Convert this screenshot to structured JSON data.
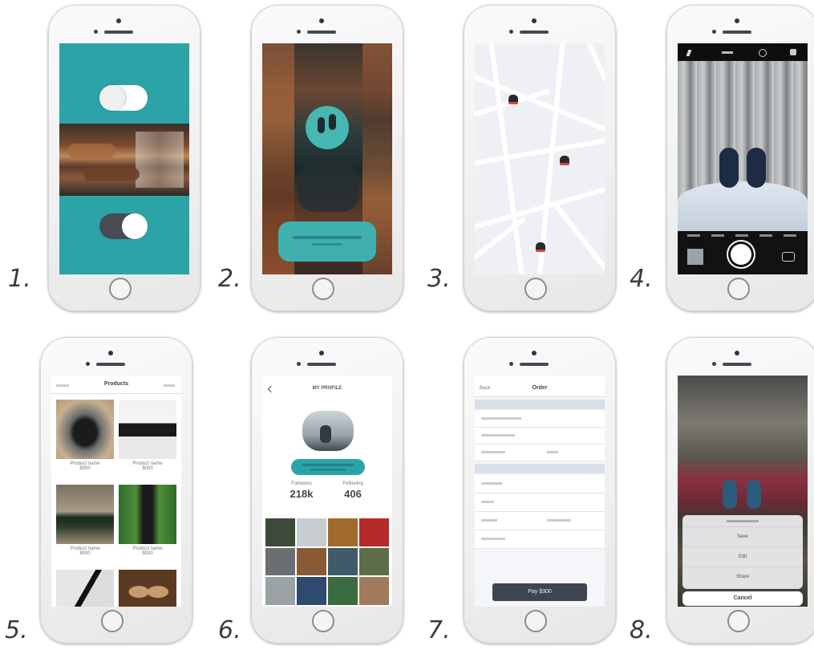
{
  "steps": [
    {
      "number": "1."
    },
    {
      "number": "2."
    },
    {
      "number": "3."
    },
    {
      "number": "4."
    },
    {
      "number": "5."
    },
    {
      "number": "6."
    },
    {
      "number": "7."
    },
    {
      "number": "8."
    }
  ],
  "screen5": {
    "header_title": "Products",
    "product_label": "Product name",
    "product_price": "$000"
  },
  "screen6": {
    "header_title": "MY PROFILE",
    "followers_label": "Followers",
    "followers_value": "218k",
    "following_label": "Following",
    "following_value": "406"
  },
  "screen7": {
    "header_back": "Back",
    "header_title": "Order",
    "pay_button": "Pay $300"
  },
  "screen8": {
    "options": [
      "Save",
      "Edit",
      "Share"
    ],
    "cancel": "Cancel"
  },
  "colors": {
    "teal": "#2ba3a7",
    "dark_button": "#3d4650",
    "map_road": "#ffffff",
    "map_bg": "#eef0f4"
  }
}
